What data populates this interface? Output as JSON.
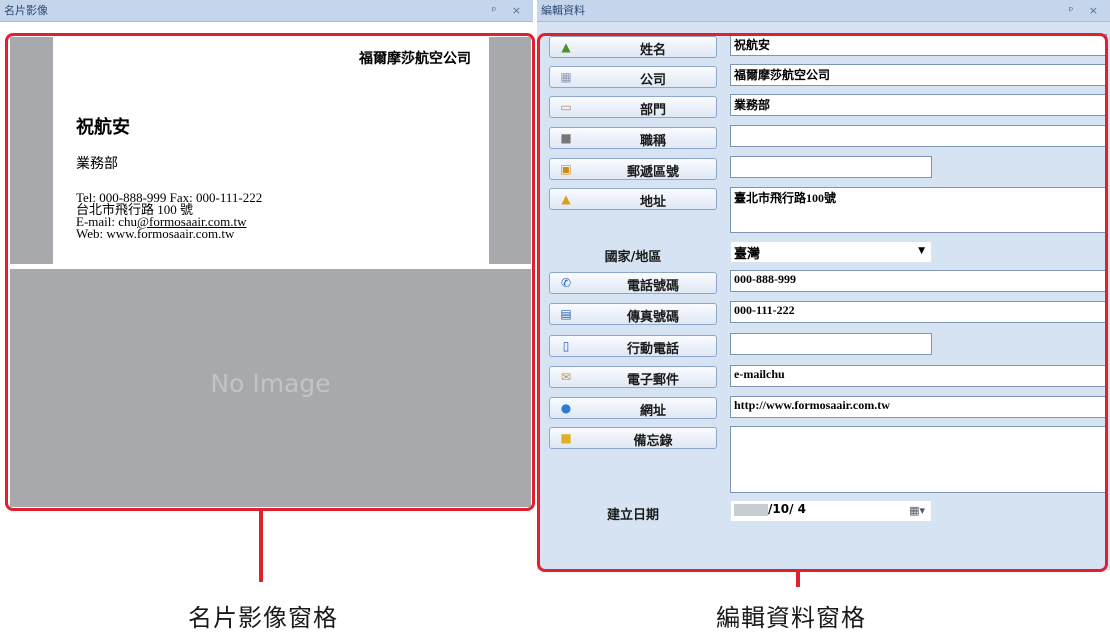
{
  "left_pane": {
    "title": "名片影像",
    "buttons": "ᵖ ×",
    "card": {
      "company": "福爾摩莎航空公司",
      "name": "祝航安",
      "department": "業務部",
      "tel_line": "Tel: 000-888-999    Fax: 000-111-222",
      "address_line": "台北市飛行路 100 號",
      "email_prefix": "E-mail: chu",
      "email_link": "@formosaair.com.tw",
      "web_line": "Web: www.formosaair.com.tw"
    },
    "back_placeholder": "No Image"
  },
  "right_pane": {
    "title": "編輯資料",
    "buttons": "ᵖ ×",
    "fields": [
      {
        "label": "姓名",
        "value": "祝航安",
        "icon": "person-icon"
      },
      {
        "label": "公司",
        "value": "福爾摩莎航空公司",
        "icon": "building-icon"
      },
      {
        "label": "部門",
        "value": "業務部",
        "icon": "door-icon"
      },
      {
        "label": "職稱",
        "value": "",
        "icon": "badge-icon"
      },
      {
        "label": "郵遞區號",
        "value": "",
        "icon": "postcode-icon"
      },
      {
        "label": "地址",
        "value": "臺北市飛行路100號",
        "icon": "home-icon"
      },
      {
        "label": "電話號碼",
        "value": "000-888-999",
        "icon": "phone-icon"
      },
      {
        "label": "傳真號碼",
        "value": "000-111-222",
        "icon": "fax-icon"
      },
      {
        "label": "行動電話",
        "value": "",
        "icon": "mobile-icon"
      },
      {
        "label": "電子郵件",
        "value": "e-mailchu",
        "icon": "mail-icon"
      },
      {
        "label": "網址",
        "value": "http://www.formosaair.com.tw",
        "icon": "globe-icon"
      },
      {
        "label": "備忘錄",
        "value": "",
        "icon": "memo-icon"
      }
    ],
    "country": {
      "label": "國家/地區",
      "value": "臺灣"
    },
    "created_date": {
      "label": "建立日期",
      "value": "/10/ 4"
    }
  },
  "captions": {
    "left": "名片影像窗格",
    "right": "編輯資料窗格"
  },
  "colors": {
    "highlight": "#e0202e",
    "pane_bg": "#d6e3f3",
    "header_bg": "#c5d6ec"
  }
}
